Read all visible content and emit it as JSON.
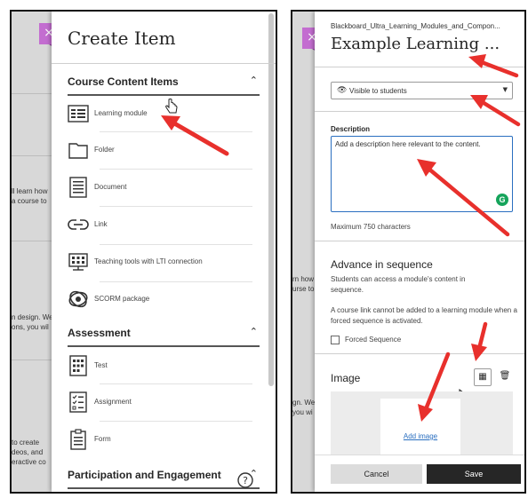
{
  "left": {
    "panel_title": "Create Item",
    "close_label": "×",
    "background_fragments": [
      "ll learn how",
      "a course to",
      "n design. We",
      "ons, you wil",
      "to create",
      "deos, and",
      "eractive co"
    ],
    "sections": [
      {
        "title": "Course Content Items",
        "chevron": "^",
        "items": [
          {
            "label": "Learning module",
            "icon": "learning-module-icon"
          },
          {
            "label": "Folder",
            "icon": "folder-icon"
          },
          {
            "label": "Document",
            "icon": "document-icon"
          },
          {
            "label": "Link",
            "icon": "link-icon"
          },
          {
            "label": "Teaching tools with LTI connection",
            "icon": "lti-tool-icon"
          },
          {
            "label": "SCORM package",
            "icon": "scorm-package-icon"
          }
        ]
      },
      {
        "title": "Assessment",
        "chevron": "^",
        "items": [
          {
            "label": "Test",
            "icon": "test-icon"
          },
          {
            "label": "Assignment",
            "icon": "assignment-icon"
          },
          {
            "label": "Form",
            "icon": "form-icon"
          }
        ]
      },
      {
        "title": "Participation and Engagement",
        "chevron": "^",
        "items": []
      }
    ],
    "help_icon": "help-icon"
  },
  "right": {
    "close_label": "×",
    "breadcrumb": "Blackboard_Ultra_Learning_Modules_and_Compon...",
    "title": "Example Learning ...",
    "background_fragments": [
      "rn how",
      "urse to",
      "gn. We",
      "you wi"
    ],
    "visibility": {
      "value": "Visible to students",
      "icon": "eye-icon"
    },
    "description": {
      "label": "Description",
      "value": "Add a description here relevant to the content.",
      "limit": "Maximum 750 characters",
      "grammar_icon": "grammarly-icon"
    },
    "sequence": {
      "heading": "Advance in sequence",
      "info": "Students can access a module's content in sequence.",
      "note": "A course link cannot be added to a learning module when a forced sequence is activated.",
      "checkbox_label": "Forced Sequence"
    },
    "image": {
      "heading": "Image",
      "add_link": "Add image",
      "icons": [
        "image-settings-icon",
        "trash-icon"
      ]
    },
    "buttons": {
      "cancel": "Cancel",
      "save": "Save"
    }
  },
  "colors": {
    "accent_purple": "#c36dd0",
    "arrow_red": "#e8302c",
    "link_blue": "#2a6fc0"
  }
}
